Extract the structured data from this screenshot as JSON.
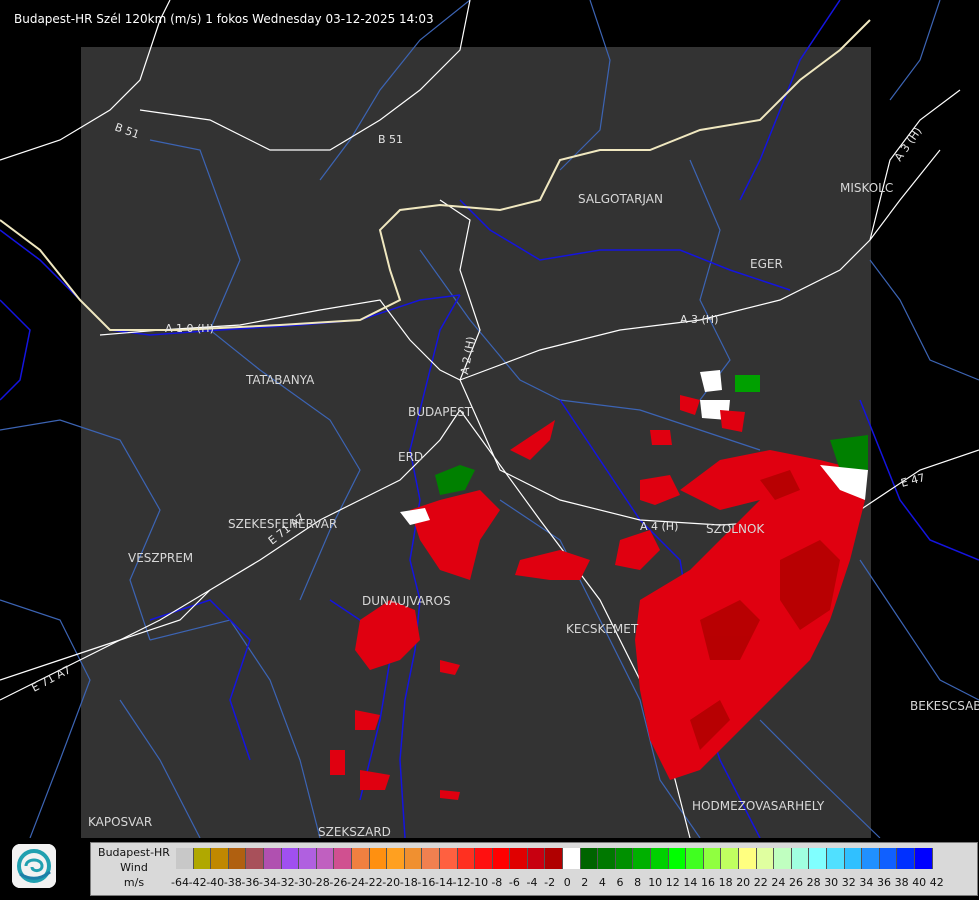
{
  "title": "Budapest-HR Szél 120km (m/s) 1 fokos Wednesday 03-12-2025 14:03",
  "places": [
    {
      "name": "SALGOTARJAN"
    },
    {
      "name": "MISKOLC"
    },
    {
      "name": "EGER"
    },
    {
      "name": "TATABANYA"
    },
    {
      "name": "BUDAPEST"
    },
    {
      "name": "ERD"
    },
    {
      "name": "SZEKESFEHERVAR"
    },
    {
      "name": "VESZPREM"
    },
    {
      "name": "DUNAUJVAROS"
    },
    {
      "name": "KECSKEMET"
    },
    {
      "name": "SZOLNOK"
    },
    {
      "name": "HODMEZOVASARHELY"
    },
    {
      "name": "BEKESCSABA"
    },
    {
      "name": "KAPOSVAR"
    },
    {
      "name": "SZEKSZARD"
    }
  ],
  "roads": [
    "B 51",
    "B 51",
    "A 3 (H)",
    "A 3 (H)",
    "A 1 0 (H)",
    "A 2 (H)",
    "A 4 (H)",
    "E 47",
    "E 71 A7",
    "E 71 A7"
  ],
  "legend": {
    "line1": "Budapest-HR",
    "line2": "Wind",
    "line3": "m/s",
    "ticks": [
      "-64",
      "-42",
      "-40",
      "-38",
      "-36",
      "-34",
      "-32",
      "-30",
      "-28",
      "-26",
      "-24",
      "-22",
      "-20",
      "-18",
      "-16",
      "-14",
      "-12",
      "-10",
      "-8",
      "-6",
      "-4",
      "-2",
      "0",
      "2",
      "4",
      "6",
      "8",
      "10",
      "12",
      "14",
      "16",
      "18",
      "20",
      "22",
      "24",
      "26",
      "28",
      "30",
      "32",
      "34",
      "36",
      "38",
      "40",
      "42"
    ],
    "colors": [
      "#c8c8c8",
      "#b0a800",
      "#c08800",
      "#b06010",
      "#a8505a",
      "#b050b0",
      "#a050f0",
      "#b060e0",
      "#c060c0",
      "#d05090",
      "#f08040",
      "#ff9010",
      "#ffa020",
      "#f09030",
      "#f08050",
      "#ff6040",
      "#ff3020",
      "#ff1010",
      "#ff0000",
      "#e00000",
      "#c80010",
      "#b00000",
      "#ffffff",
      "#006400",
      "#007800",
      "#009000",
      "#00b000",
      "#00d000",
      "#00ff00",
      "#40ff20",
      "#90ff40",
      "#c0ff60",
      "#ffff80",
      "#e0ffa0",
      "#c0ffc0",
      "#a0ffe0",
      "#80ffff",
      "#50e0ff",
      "#30c0ff",
      "#2090ff",
      "#1060ff",
      "#0030ff",
      "#0000ff"
    ]
  },
  "colors": {
    "background": "#000000",
    "radar_area": "#333333",
    "border": "#ffffff",
    "river": "#1414e0",
    "road": "#ffffff",
    "admin": "#3c64b4",
    "negative_wind": "#ff0000",
    "positive_wind": "#009000"
  }
}
